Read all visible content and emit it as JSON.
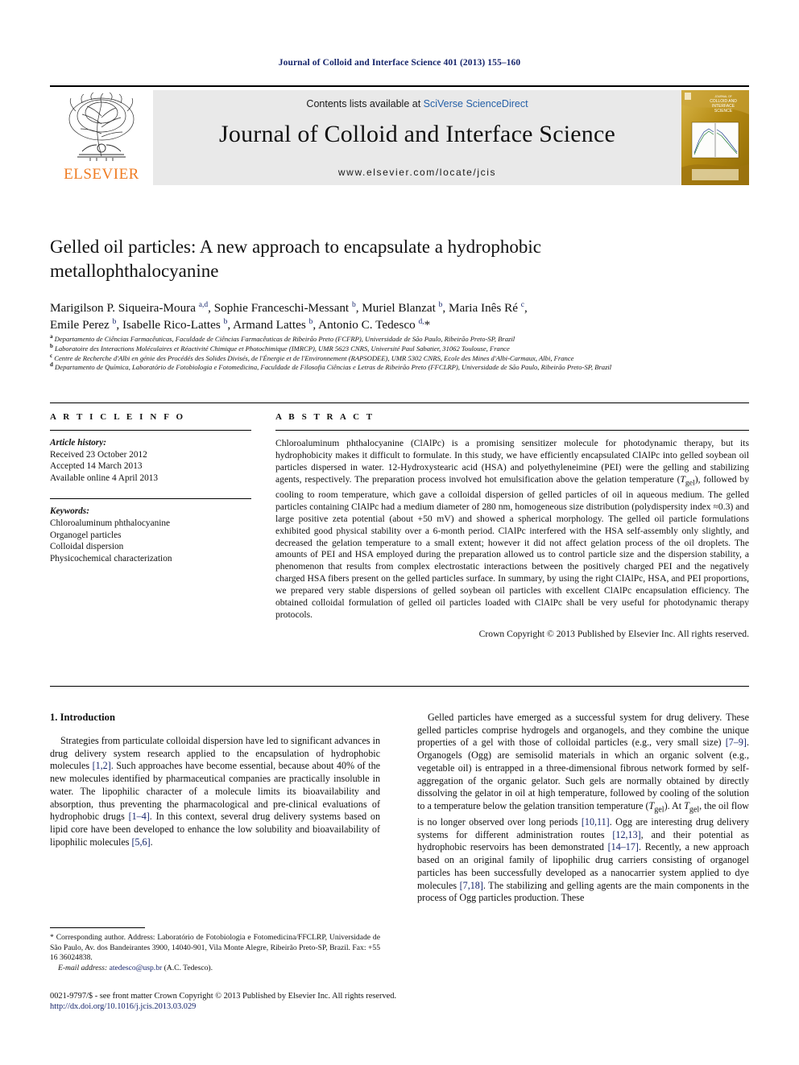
{
  "running_head": "Journal of Colloid and Interface Science 401 (2013) 155–160",
  "masthead": {
    "publisher_name": "ELSEVIER",
    "contents_prefix": "Contents lists available at ",
    "contents_link": "SciVerse ScienceDirect",
    "journal_title": "Journal of Colloid and Interface Science",
    "journal_url": "www.elsevier.com/locate/jcis",
    "cover_title_line1": "COLLOID AND",
    "cover_title_line2": "INTERFACE",
    "cover_title_line3": "SCIENCE"
  },
  "article": {
    "title": "Gelled oil particles: A new approach to encapsulate a hydrophobic metallophthalocyanine",
    "authors_line1": "Marigilson P. Siqueira-Moura <sup>a,d</sup>, Sophie Franceschi-Messant <sup>b</sup>, Muriel Blanzat <sup>b</sup>, Maria Inês Ré <sup>c</sup>,",
    "authors_line2": "Emile Perez <sup>b</sup>, Isabelle Rico-Lattes <sup>b</sup>, Armand Lattes <sup>b</sup>, Antonio C. Tedesco <sup>d,</sup>*",
    "affiliations": [
      "<sup>a</sup> Departamento de Ciências Farmacêuticas, Faculdade de Ciências Farmacêuticas de Ribeirão Preto (FCFRP), Universidade de São Paulo, Ribeirão Preto-SP, Brazil",
      "<sup>b</sup> Laboratoire des Interactions Moléculaires et Réactivité Chimique et Photochimique (IMRCP), UMR 5623 CNRS, Université Paul Sabatier, 31062 Toulouse, France",
      "<sup>c</sup> Centre de Recherche d'Albi en génie des Procédés des Solides Divisés, de l'Énergie et de l'Environnement (RAPSODEE), UMR 5302 CNRS, Ecole des Mines d'Albi-Carmaux, Albi, France",
      "<sup>d</sup> Departamento de Química, Laboratório de Fotobiologia e Fotomedicina, Faculdade de Filosofia Ciências e Letras de Ribeirão Preto (FFCLRP), Universidade de São Paulo, Ribeirão Preto-SP, Brazil"
    ]
  },
  "article_info": {
    "heading": "A R T I C L E   I N F O",
    "history_label": "Article history:",
    "history": [
      "Received 23 October 2012",
      "Accepted 14 March 2013",
      "Available online 4 April 2013"
    ],
    "keywords_label": "Keywords:",
    "keywords": [
      "Chloroaluminum phthalocyanine",
      "Organogel particles",
      "Colloidal dispersion",
      "Physicochemical characterization"
    ]
  },
  "abstract": {
    "heading": "A B S T R A C T",
    "text": "Chloroaluminum phthalocyanine (ClAlPc) is a promising sensitizer molecule for photodynamic therapy, but its hydrophobicity makes it difficult to formulate. In this study, we have efficiently encapsulated ClAlPc into gelled soybean oil particles dispersed in water. 12-Hydroxystearic acid (HSA) and polyethyleneimine (PEI) were the gelling and stabilizing agents, respectively. The preparation process involved hot emulsification above the gelation temperature (<i>T</i><sub>gel</sub>), followed by cooling to room temperature, which gave a colloidal dispersion of gelled particles of oil in aqueous medium. The gelled particles containing ClAlPc had a medium diameter of 280 nm, homogeneous size distribution (polydispersity index ≈0.3) and large positive zeta potential (about +50 mV) and showed a spherical morphology. The gelled oil particle formulations exhibited good physical stability over a 6-month period. ClAlPc interfered with the HSA self-assembly only slightly, and decreased the gelation temperature to a small extent; however it did not affect gelation process of the oil droplets. The amounts of PEI and HSA employed during the preparation allowed us to control particle size and the dispersion stability, a phenomenon that results from complex electrostatic interactions between the positively charged PEI and the negatively charged HSA fibers present on the gelled particles surface. In summary, by using the right ClAlPc, HSA, and PEI proportions, we prepared very stable dispersions of gelled soybean oil particles with excellent ClAlPc encapsulation efficiency. The obtained colloidal formulation of gelled oil particles loaded with ClAlPc shall be very useful for photodynamic therapy protocols.",
    "copyright": "Crown Copyright © 2013 Published by Elsevier Inc. All rights reserved."
  },
  "introduction": {
    "heading": "1. Introduction",
    "left_paragraph": "Strategies from particulate colloidal dispersion have led to significant advances in drug delivery system research applied to the encapsulation of hydrophobic molecules <span class=\"ref\">[1,2]</span>. Such approaches have become essential, because about 40% of the new molecules identified by pharmaceutical companies are practically insoluble in water. The lipophilic character of a molecule limits its bioavailability and absorption, thus preventing the pharmacological and pre-clinical evaluations of hydrophobic drugs <span class=\"ref\">[1–4]</span>. In this context, several drug delivery systems based on lipid core have been developed to enhance the low solubility and bioavailability of lipophilic molecules <span class=\"ref\">[5,6]</span>.",
    "right_paragraph": "Gelled particles have emerged as a successful system for drug delivery. These gelled particles comprise hydrogels and organogels, and they combine the unique properties of a gel with those of colloidal particles (e.g., very small size) <span class=\"ref\">[7–9]</span>. Organogels (Ogg) are semisolid materials in which an organic solvent (e.g., vegetable oil) is entrapped in a three-dimensional fibrous network formed by self-aggregation of the organic gelator. Such gels are normally obtained by directly dissolving the gelator in oil at high temperature, followed by cooling of the solution to a temperature below the gelation transition temperature (<i>T</i><sub>gel</sub>). At <i>T</i><sub>gel</sub>, the oil flow is no longer observed over long periods <span class=\"ref\">[10,11]</span>. Ogg are interesting drug delivery systems for different administration routes <span class=\"ref\">[12,13]</span>, and their potential as hydrophobic reservoirs has been demonstrated <span class=\"ref\">[14–17]</span>. Recently, a new approach based on an original family of lipophilic drug carriers consisting of organogel particles has been successfully developed as a nanocarrier system applied to dye molecules <span class=\"ref\">[7,18]</span>. The stabilizing and gelling agents are the main components in the process of Ogg particles production. These"
  },
  "footnote": {
    "corresponding": "* Corresponding author. Address: Laboratório de Fotobiologia e Fotomedicina/FFCLRP, Universidade de São Paulo, Av. dos Bandeirantes 3900, 14040-901, Vila Monte Alegre, Ribeirão Preto-SP, Brazil. Fax: +55 16 36024838.",
    "email_label": "E-mail address:",
    "email": "atedesco@usp.br",
    "email_suffix": " (A.C. Tedesco)."
  },
  "page_footer": {
    "issn_line": "0021-9797/$ - see front matter Crown Copyright © 2013 Published by Elsevier Inc. All rights reserved.",
    "doi": "http://dx.doi.org/10.1016/j.jcis.2013.03.029"
  },
  "colors": {
    "link_blue": "#16256b",
    "sciencedirect_blue": "#2560a8",
    "elsevier_orange": "#ef7c22",
    "masthead_grey": "#e9e9e9",
    "cover_gold": "#c59a1e"
  }
}
